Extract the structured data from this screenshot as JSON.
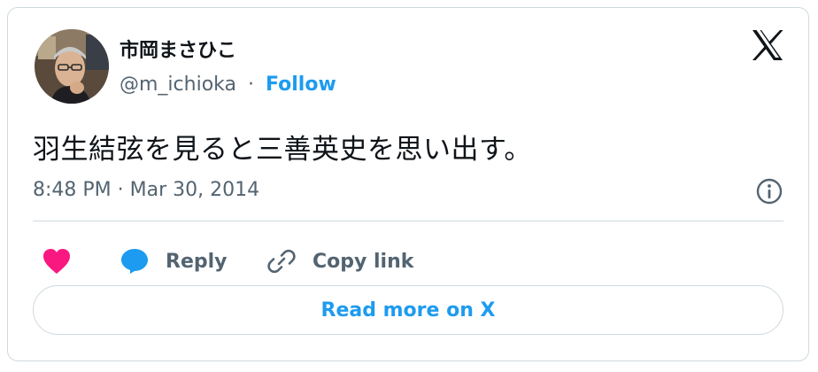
{
  "author": {
    "display_name": "市岡まさひこ",
    "handle": "@m_ichioka",
    "separator": "·",
    "follow_label": "Follow"
  },
  "tweet": {
    "text": "羽生結弦を見ると三善英史を思い出す。",
    "timestamp": "8:48 PM · Mar 30, 2014"
  },
  "actions": {
    "like_icon": "heart-icon",
    "reply_label": "Reply",
    "copy_link_label": "Copy link"
  },
  "footer": {
    "read_more_label": "Read more on X"
  },
  "icons": {
    "brand": "x-logo-icon",
    "info": "info-icon",
    "reply": "speech-bubble-icon",
    "copy": "link-icon"
  },
  "colors": {
    "accent": "#1d9bf0",
    "like": "#f91880",
    "text_primary": "#0f1419",
    "text_secondary": "#536471",
    "border": "#cfd9de"
  }
}
